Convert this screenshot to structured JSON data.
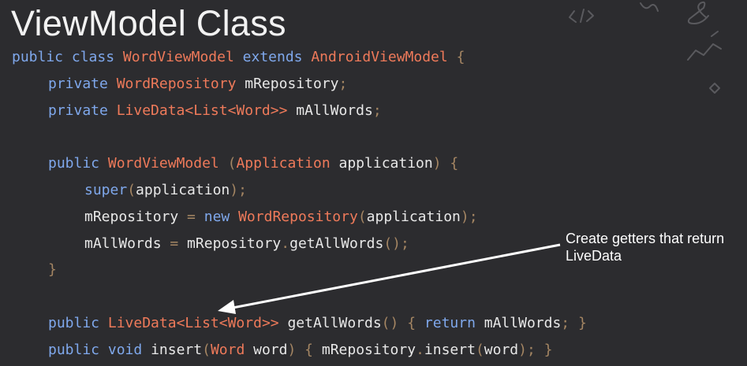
{
  "slide": {
    "title": "ViewModel Class",
    "annotation": "Create getters that return LiveData"
  },
  "colors": {
    "background": "#2c2c2f",
    "keyword": "#7fa8ec",
    "type": "#ef7a5a",
    "text": "#e8e8e8",
    "punct": "#a58663",
    "annotation": "#ffffff"
  },
  "code": {
    "lines": [
      {
        "indent": 0,
        "tokens": [
          [
            "k",
            "public"
          ],
          [
            "t",
            " "
          ],
          [
            "k",
            "class"
          ],
          [
            "t",
            " "
          ],
          [
            "y",
            "WordViewModel"
          ],
          [
            "t",
            " "
          ],
          [
            "k",
            "extends"
          ],
          [
            "t",
            " "
          ],
          [
            "y",
            "AndroidViewModel"
          ],
          [
            "t",
            " "
          ],
          [
            "p",
            "{"
          ]
        ]
      },
      {
        "indent": 1,
        "tokens": [
          [
            "k",
            "private"
          ],
          [
            "t",
            " "
          ],
          [
            "y",
            "WordRepository"
          ],
          [
            "t",
            " mRepository"
          ],
          [
            "p",
            ";"
          ]
        ]
      },
      {
        "indent": 1,
        "tokens": [
          [
            "k",
            "private"
          ],
          [
            "t",
            " "
          ],
          [
            "y",
            "LiveData<List<Word>>"
          ],
          [
            "t",
            " mAllWords"
          ],
          [
            "p",
            ";"
          ]
        ]
      },
      {
        "indent": 0,
        "tokens": []
      },
      {
        "indent": 1,
        "tokens": [
          [
            "k",
            "public"
          ],
          [
            "t",
            " "
          ],
          [
            "y",
            "WordViewModel"
          ],
          [
            "t",
            " "
          ],
          [
            "p",
            "("
          ],
          [
            "y",
            "Application"
          ],
          [
            "t",
            " application"
          ],
          [
            "p",
            ")"
          ],
          [
            "t",
            " "
          ],
          [
            "p",
            "{"
          ]
        ]
      },
      {
        "indent": 2,
        "tokens": [
          [
            "k",
            "super"
          ],
          [
            "p",
            "("
          ],
          [
            "t",
            "application"
          ],
          [
            "p",
            ");"
          ]
        ]
      },
      {
        "indent": 2,
        "tokens": [
          [
            "t",
            "mRepository "
          ],
          [
            "p",
            "="
          ],
          [
            "t",
            " "
          ],
          [
            "k",
            "new"
          ],
          [
            "t",
            " "
          ],
          [
            "y",
            "WordRepository"
          ],
          [
            "p",
            "("
          ],
          [
            "t",
            "application"
          ],
          [
            "p",
            ");"
          ]
        ]
      },
      {
        "indent": 2,
        "tokens": [
          [
            "t",
            "mAllWords "
          ],
          [
            "p",
            "="
          ],
          [
            "t",
            " mRepository"
          ],
          [
            "p",
            "."
          ],
          [
            "t",
            "getAllWords"
          ],
          [
            "p",
            "();"
          ]
        ]
      },
      {
        "indent": 1,
        "tokens": [
          [
            "p",
            "}"
          ]
        ]
      },
      {
        "indent": 0,
        "tokens": []
      },
      {
        "indent": 1,
        "tokens": [
          [
            "k",
            "public"
          ],
          [
            "t",
            " "
          ],
          [
            "y",
            "LiveData<List<Word>>"
          ],
          [
            "t",
            " getAllWords"
          ],
          [
            "p",
            "()"
          ],
          [
            "t",
            " "
          ],
          [
            "p",
            "{"
          ],
          [
            "t",
            " "
          ],
          [
            "k",
            "return"
          ],
          [
            "t",
            " mAllWords"
          ],
          [
            "p",
            ";"
          ],
          [
            "t",
            " "
          ],
          [
            "p",
            "}"
          ]
        ]
      },
      {
        "indent": 1,
        "tokens": [
          [
            "k",
            "public"
          ],
          [
            "t",
            " "
          ],
          [
            "k",
            "void"
          ],
          [
            "t",
            " insert"
          ],
          [
            "p",
            "("
          ],
          [
            "y",
            "Word"
          ],
          [
            "t",
            " word"
          ],
          [
            "p",
            ")"
          ],
          [
            "t",
            " "
          ],
          [
            "p",
            "{"
          ],
          [
            "t",
            " mRepository"
          ],
          [
            "p",
            "."
          ],
          [
            "t",
            "insert"
          ],
          [
            "p",
            "("
          ],
          [
            "t",
            "word"
          ],
          [
            "p",
            ");"
          ],
          [
            "t",
            " "
          ],
          [
            "p",
            "}"
          ]
        ]
      }
    ]
  }
}
